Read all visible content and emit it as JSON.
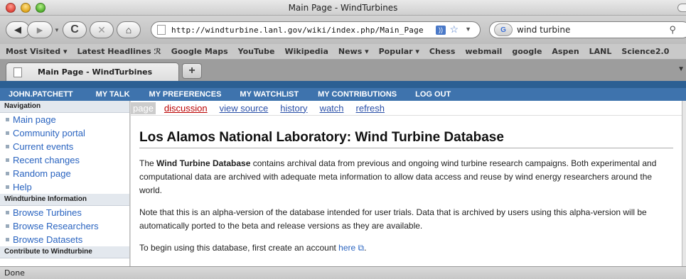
{
  "window": {
    "title": "Main Page - WindTurbines"
  },
  "toolbar": {
    "url": "http://windturbine.lanl.gov/wiki/index.php/Main_Page",
    "search_value": "wind turbine",
    "search_engine_badge": "G"
  },
  "bookmarks": [
    "Most Visited ▾",
    "Latest Headlines ℛ",
    "Google Maps",
    "YouTube",
    "Wikipedia",
    "News ▾",
    "Popular ▾",
    "Chess",
    "webmail",
    "google",
    "Aspen",
    "LANL",
    "Science2.0"
  ],
  "tab": {
    "title": "Main Page - WindTurbines"
  },
  "userbar": [
    "JOHN.PATCHETT",
    "MY TALK",
    "MY PREFERENCES",
    "MY WATCHLIST",
    "MY CONTRIBUTIONS",
    "LOG OUT"
  ],
  "sidebar": {
    "navigation_header": "Navigation",
    "navigation": [
      "Main page",
      "Community portal",
      "Current events",
      "Recent changes",
      "Random page",
      "Help"
    ],
    "windturbine_header": "Windturbine Information",
    "windturbine": [
      "Browse Turbines",
      "Browse Researchers",
      "Browse Datasets"
    ],
    "contribute_header": "Contribute to Windturbine"
  },
  "content_tabs": [
    "page",
    "discussion",
    "view source",
    "history",
    "watch",
    "refresh"
  ],
  "content": {
    "title": "Los Alamos National Laboratory: Wind Turbine Database",
    "p1_pre": "The ",
    "p1_bold": "Wind Turbine Database",
    "p1_post": " contains archival data from previous and ongoing wind turbine research campaigns. Both experimental and computational data are archived with adequate meta information to allow data access and reuse by wind energy researchers around the world.",
    "p2": "Note that this is an alpha-version of the database intended for user trials. Data that is archived by users using this alpha-version will be automatically ported to the beta and release versions as they are available.",
    "p3_pre": "To begin using this database, first create an account ",
    "p3_link": "here",
    "p3_post": "."
  },
  "status": "Done"
}
